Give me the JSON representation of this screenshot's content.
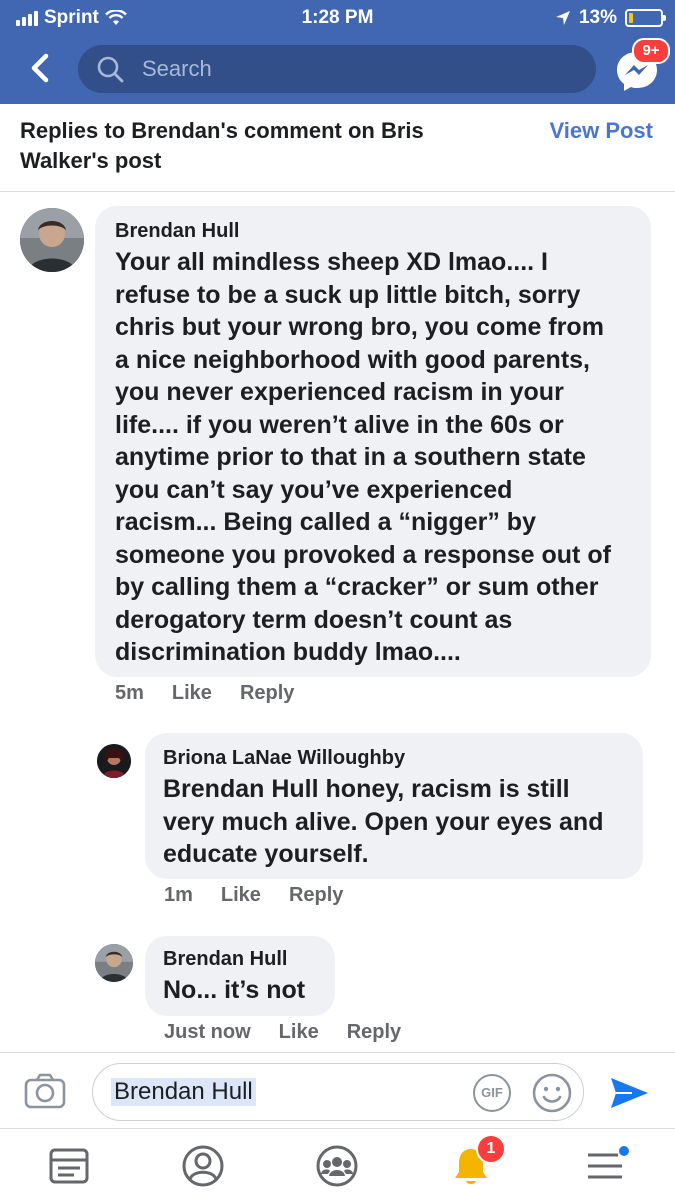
{
  "status_bar": {
    "carrier": "Sprint",
    "time": "1:28 PM",
    "battery": "13%",
    "battery_level": 0.13
  },
  "nav": {
    "search_placeholder": "Search",
    "messenger_badge": "9+"
  },
  "header": {
    "title": "Replies to Brendan's comment on Bris Walker's post",
    "view_post": "View Post"
  },
  "comments": [
    {
      "author": "Brendan Hull",
      "lines": [
        "Your all mindless sheep XD lmao.... I",
        "refuse to be a suck up little bitch, sorry",
        "chris but your wrong bro, you come from",
        "a nice neighborhood with good parents,",
        "you never experienced racism in your",
        "life.... if you weren’t alive in the 60s or",
        "anytime prior to that in a southern state",
        "you can’t say you’ve experienced",
        "racism... Being called a “nigger” by",
        "someone you provoked a response out of",
        "by calling them a “cracker” or sum other",
        "derogatory term doesn’t count as",
        "discrimination buddy lmao...."
      ],
      "time": "5m",
      "like": "Like",
      "reply": "Reply"
    },
    {
      "author": "Briona LaNae Willoughby",
      "mention": "Brendan Hull",
      "lines": [
        " honey, racism is still",
        "very much alive. Open your eyes and",
        "educate yourself."
      ],
      "time": "1m",
      "like": "Like",
      "reply": "Reply"
    },
    {
      "author": "Brendan Hull",
      "lines": [
        "No... it’s not"
      ],
      "time": "Just now",
      "like": "Like",
      "reply": "Reply"
    }
  ],
  "composer": {
    "value": "Brendan Hull",
    "gif_label": "GIF"
  },
  "tabbar": {
    "notification_badge": "1"
  },
  "colors": {
    "brand_blue": "#4267b2",
    "link_blue": "#4a76d0",
    "badge_red": "#fa3e3e",
    "bubble_grey": "#f0f1f4"
  }
}
